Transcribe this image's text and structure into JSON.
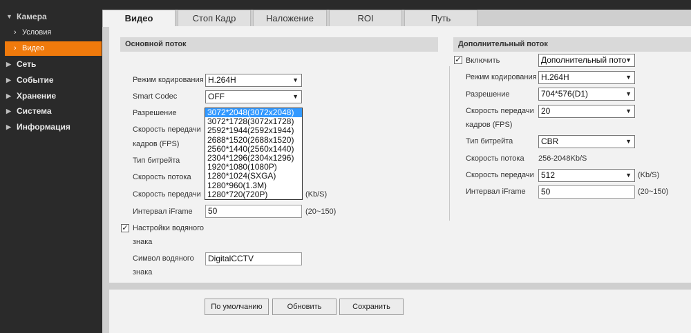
{
  "sidebar": {
    "camera": "Камера",
    "sub": [
      "Условия",
      "Видео"
    ],
    "items": [
      "Сеть",
      "Событие",
      "Хранение",
      "Система",
      "Информация"
    ]
  },
  "tabs": [
    "Видео",
    "Стоп Кадр",
    "Наложение",
    "ROI",
    "Путь"
  ],
  "main": {
    "title": "Основной поток",
    "enc_label": "Режим кодирования",
    "enc_value": "H.264H",
    "smart_label": "Smart Codec",
    "smart_value": "OFF",
    "res_label": "Разрешение",
    "res_selected": "3072*2048(3072x2048)",
    "res_options": [
      "3072*2048(3072x2048)",
      "3072*1728(3072x1728)",
      "2592*1944(2592x1944)",
      "2688*1520(2688x1520)",
      "2560*1440(2560x1440)",
      "2304*1296(2304x1296)",
      "1920*1080(1080P)",
      "1280*1024(SXGA)",
      "1280*960(1.3M)",
      "1280*720(720P)"
    ],
    "fps_label_1": "Скорость передачи",
    "fps_label_2": "кадров (FPS)",
    "bitrate_type_label": "Тип битрейта",
    "stream_speed_label": "Скорость потока",
    "bitrate_label": "Скорость передачи",
    "bitrate_unit": "(Kb/S)",
    "iframe_label": "Интервал iFrame",
    "iframe_value": "50",
    "iframe_range": "(20~150)",
    "watermark_label_1": "Настройки водяного",
    "watermark_label_2": "знака",
    "watermark_checked": true,
    "wm_symbol_label_1": "Символ водяного",
    "wm_symbol_label_2": "знака",
    "wm_symbol_value": "DigitalCCTV"
  },
  "extra": {
    "title": "Дополнительный поток",
    "enable_label": "Включить",
    "enable_checked": true,
    "stream_value": "Дополнительный пото",
    "enc_label": "Режим кодирования",
    "enc_value": "H.264H",
    "res_label": "Разрешение",
    "res_value": "704*576(D1)",
    "fps_label_1": "Скорость передачи",
    "fps_label_2": "кадров (FPS)",
    "fps_value": "20",
    "bitrate_type_label": "Тип битрейта",
    "bitrate_type_value": "CBR",
    "stream_speed_label": "Скорость потока",
    "stream_speed_value": "256-2048Kb/S",
    "bitrate_label": "Скорость передачи",
    "bitrate_value": "512",
    "bitrate_unit": "(Kb/S)",
    "iframe_label": "Интервал iFrame",
    "iframe_value": "50",
    "iframe_range": "(20~150)"
  },
  "buttons": {
    "default": "По умолчанию",
    "refresh": "Обновить",
    "save": "Сохранить"
  },
  "colors": {
    "active_item": "#f07a0c",
    "sidebar_bg": "#2a2a2a",
    "highlight_option": "#3399ff"
  }
}
